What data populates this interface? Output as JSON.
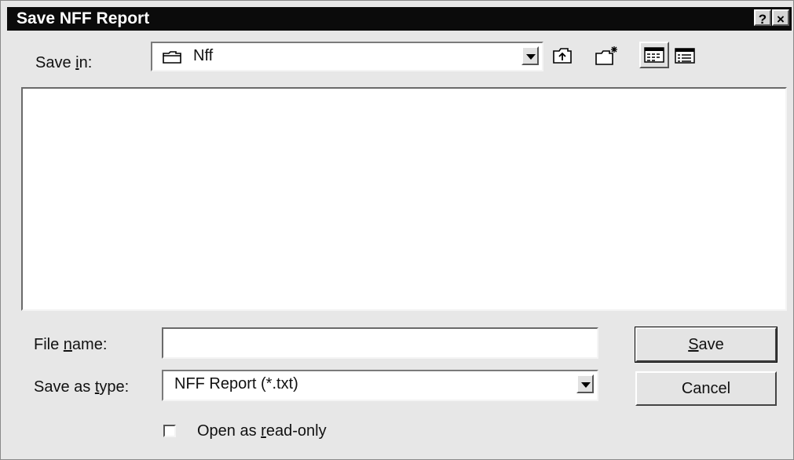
{
  "window": {
    "title": "Save NFF Report",
    "help_button": "?",
    "close_button": "×"
  },
  "save_in": {
    "label_pre": "Save ",
    "label_accel": "i",
    "label_post": "n:",
    "folder": "Nff"
  },
  "toolbar": {
    "icons": [
      "up-one-level-icon",
      "create-new-folder-icon",
      "list-view-icon",
      "details-view-icon"
    ]
  },
  "file_list": {
    "items": []
  },
  "file_name": {
    "label_pre": "File ",
    "label_accel": "n",
    "label_post": "ame:",
    "value": ""
  },
  "save_as_type": {
    "label_pre": "Save as ",
    "label_accel": "t",
    "label_post": "ype:",
    "value": "NFF Report (*.txt)"
  },
  "buttons": {
    "save_accel": "S",
    "save_post": "ave",
    "cancel": "Cancel"
  },
  "read_only": {
    "label_pre": "Open as ",
    "label_accel": "r",
    "label_post": "ead-only",
    "checked": false
  }
}
